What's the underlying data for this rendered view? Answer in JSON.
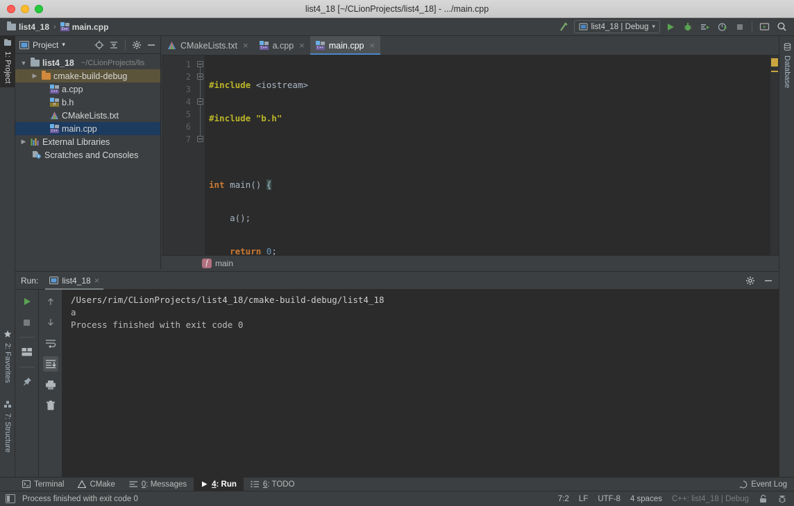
{
  "window": {
    "title": "list4_18 [~/CLionProjects/list4_18] - .../main.cpp"
  },
  "navbar": {
    "crumb_project": "list4_18",
    "crumb_sep": "›",
    "crumb_file": "main.cpp",
    "run_config": "list4_18 | Debug",
    "chevron": "▾"
  },
  "left_strip": {
    "project_tab": "1: Project",
    "favorites_tab": "2: Favorites",
    "structure_tab": "7: Structure"
  },
  "right_strip": {
    "database_tab": "Database"
  },
  "project_panel": {
    "title": "Project",
    "chevron": "▾",
    "tree": [
      {
        "label": "list4_18",
        "path": "~/CLionProjects/lis",
        "twist": "▼",
        "indent": 0,
        "icon": "folder",
        "state": "root"
      },
      {
        "label": "cmake-build-debug",
        "path": "",
        "twist": "▶",
        "indent": 1,
        "icon": "folder-orange",
        "state": "build"
      },
      {
        "label": "a.cpp",
        "path": "",
        "twist": "",
        "indent": 2,
        "icon": "cpp",
        "state": "normal"
      },
      {
        "label": "b.h",
        "path": "",
        "twist": "",
        "indent": 2,
        "icon": "header",
        "state": "normal"
      },
      {
        "label": "CMakeLists.txt",
        "path": "",
        "twist": "",
        "indent": 2,
        "icon": "cmake",
        "state": "normal"
      },
      {
        "label": "main.cpp",
        "path": "",
        "twist": "",
        "indent": 2,
        "icon": "cpp",
        "state": "selected"
      },
      {
        "label": "External Libraries",
        "path": "",
        "twist": "▶",
        "indent": 0,
        "icon": "library",
        "state": "normal"
      },
      {
        "label": "Scratches and Consoles",
        "path": "",
        "twist": "",
        "indent": 0,
        "icon": "scratch",
        "state": "normal"
      }
    ]
  },
  "editor": {
    "tabs": [
      {
        "label": "CMakeLists.txt",
        "icon": "cmake",
        "active": false
      },
      {
        "label": "a.cpp",
        "icon": "cpp",
        "active": false
      },
      {
        "label": "main.cpp",
        "icon": "cpp",
        "active": true
      }
    ],
    "close_glyph": "×",
    "line_numbers": [
      "1",
      "2",
      "3",
      "4",
      "5",
      "6",
      "7"
    ],
    "code_lines": [
      {
        "n": 1,
        "tokens": [
          {
            "t": "#include ",
            "c": "inc"
          },
          {
            "t": "<iostream>",
            "c": "incp"
          }
        ]
      },
      {
        "n": 2,
        "tokens": [
          {
            "t": "#include ",
            "c": "inc"
          },
          {
            "t": "\"b.h\"",
            "c": "inc"
          }
        ]
      },
      {
        "n": 3,
        "tokens": []
      },
      {
        "n": 4,
        "tokens": [
          {
            "t": "int ",
            "c": "kw"
          },
          {
            "t": "main",
            "c": "fn"
          },
          {
            "t": "() ",
            "c": "punct"
          },
          {
            "t": "{",
            "c": "brace"
          }
        ]
      },
      {
        "n": 5,
        "tokens": [
          {
            "t": "    a();",
            "c": "fn"
          }
        ]
      },
      {
        "n": 6,
        "tokens": [
          {
            "t": "    return ",
            "c": "kw"
          },
          {
            "t": "0",
            "c": "num"
          },
          {
            "t": ";",
            "c": "punct"
          }
        ]
      },
      {
        "n": 7,
        "tokens": [
          {
            "t": "}",
            "c": "brace"
          }
        ]
      }
    ],
    "breadcrumb_function": "main",
    "breadcrumb_badge": "f"
  },
  "run_window": {
    "label": "Run:",
    "tab_name": "list4_18",
    "close_glyph": "×",
    "console_lines": [
      "/Users/rim/CLionProjects/list4_18/cmake-build-debug/list4_18",
      "a",
      "Process finished with exit code 0"
    ]
  },
  "bottom_tabs": [
    {
      "num": "",
      "label": "Terminal",
      "icon": "terminal-icon",
      "active": false
    },
    {
      "num": "",
      "label": "CMake",
      "icon": "cmake-icon",
      "active": false
    },
    {
      "num": "0",
      "label": ": Messages",
      "icon": "messages-icon",
      "active": false
    },
    {
      "num": "4",
      "label": ": Run",
      "icon": "run-icon",
      "active": true
    },
    {
      "num": "6",
      "label": ": TODO",
      "icon": "todo-icon",
      "active": false
    }
  ],
  "event_log": "Event Log",
  "status_bar": {
    "message": "Process finished with exit code 0",
    "caret": "7:2",
    "line_sep": "LF",
    "encoding": "UTF-8",
    "indent": "4 spaces",
    "toolchain": "C++: list4_18 | Debug"
  },
  "colors": {
    "panel": "#3c3f41",
    "editor_bg": "#2b2b2b",
    "selection": "#1d3a5f",
    "build_folder": "#5c543a",
    "accent_blue": "#4a88c7",
    "run_green": "#5aa352",
    "warn_yellow": "#c9a540",
    "keyword": "#cc7832",
    "preproc": "#bbb529",
    "string": "#a5c261",
    "number": "#6897bb",
    "text": "#a9b7c6"
  }
}
